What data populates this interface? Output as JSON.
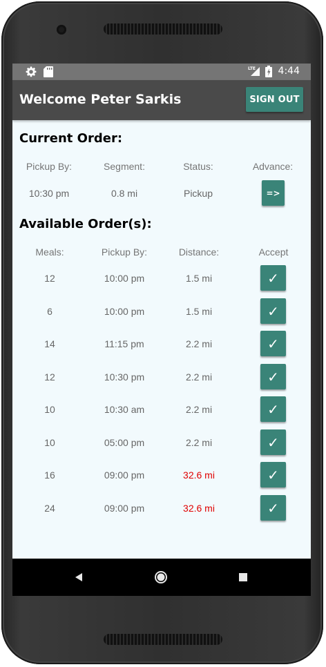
{
  "status_bar": {
    "time": "4:44",
    "icons": [
      "settings-icon",
      "sd-card-icon",
      "lte-signal-icon",
      "battery-icon"
    ],
    "lte_label": "LTE"
  },
  "app_bar": {
    "title": "Welcome Peter Sarkis",
    "sign_out_label": "SIGN OUT"
  },
  "current_order": {
    "title": "Current Order:",
    "headers": {
      "pickup_by": "Pickup By:",
      "segment": "Segment:",
      "status": "Status:",
      "advance": "Advance:"
    },
    "row": {
      "pickup_by": "10:30 pm",
      "segment": "0.8 mi",
      "status": "Pickup",
      "advance_label": "=>"
    }
  },
  "available_orders": {
    "title": "Available Order(s):",
    "headers": {
      "meals": "Meals:",
      "pickup_by": "Pickup By:",
      "distance": "Distance:",
      "accept": "Accept"
    },
    "accept_label": "✓",
    "rows": [
      {
        "meals": "12",
        "pickup_by": "10:00 pm",
        "distance": "1.5 mi",
        "far": false
      },
      {
        "meals": "6",
        "pickup_by": "10:00 pm",
        "distance": "1.5 mi",
        "far": false
      },
      {
        "meals": "14",
        "pickup_by": "11:15 pm",
        "distance": "2.2 mi",
        "far": false
      },
      {
        "meals": "12",
        "pickup_by": "10:30 pm",
        "distance": "2.2 mi",
        "far": false
      },
      {
        "meals": "10",
        "pickup_by": "10:30 am",
        "distance": "2.2 mi",
        "far": false
      },
      {
        "meals": "10",
        "pickup_by": "05:00 pm",
        "distance": "2.2 mi",
        "far": false
      },
      {
        "meals": "16",
        "pickup_by": "09:00 pm",
        "distance": "32.6 mi",
        "far": true
      },
      {
        "meals": "24",
        "pickup_by": "09:00 pm",
        "distance": "32.6 mi",
        "far": true
      }
    ]
  },
  "nav_bar": {
    "buttons": [
      "back-icon",
      "home-icon",
      "recents-icon"
    ]
  },
  "colors": {
    "accent": "#3a8478",
    "app_bar": "#4a4a4a",
    "status_bar": "#757575",
    "far_distance": "#e00000",
    "screen_bg": "#f2fafd"
  }
}
